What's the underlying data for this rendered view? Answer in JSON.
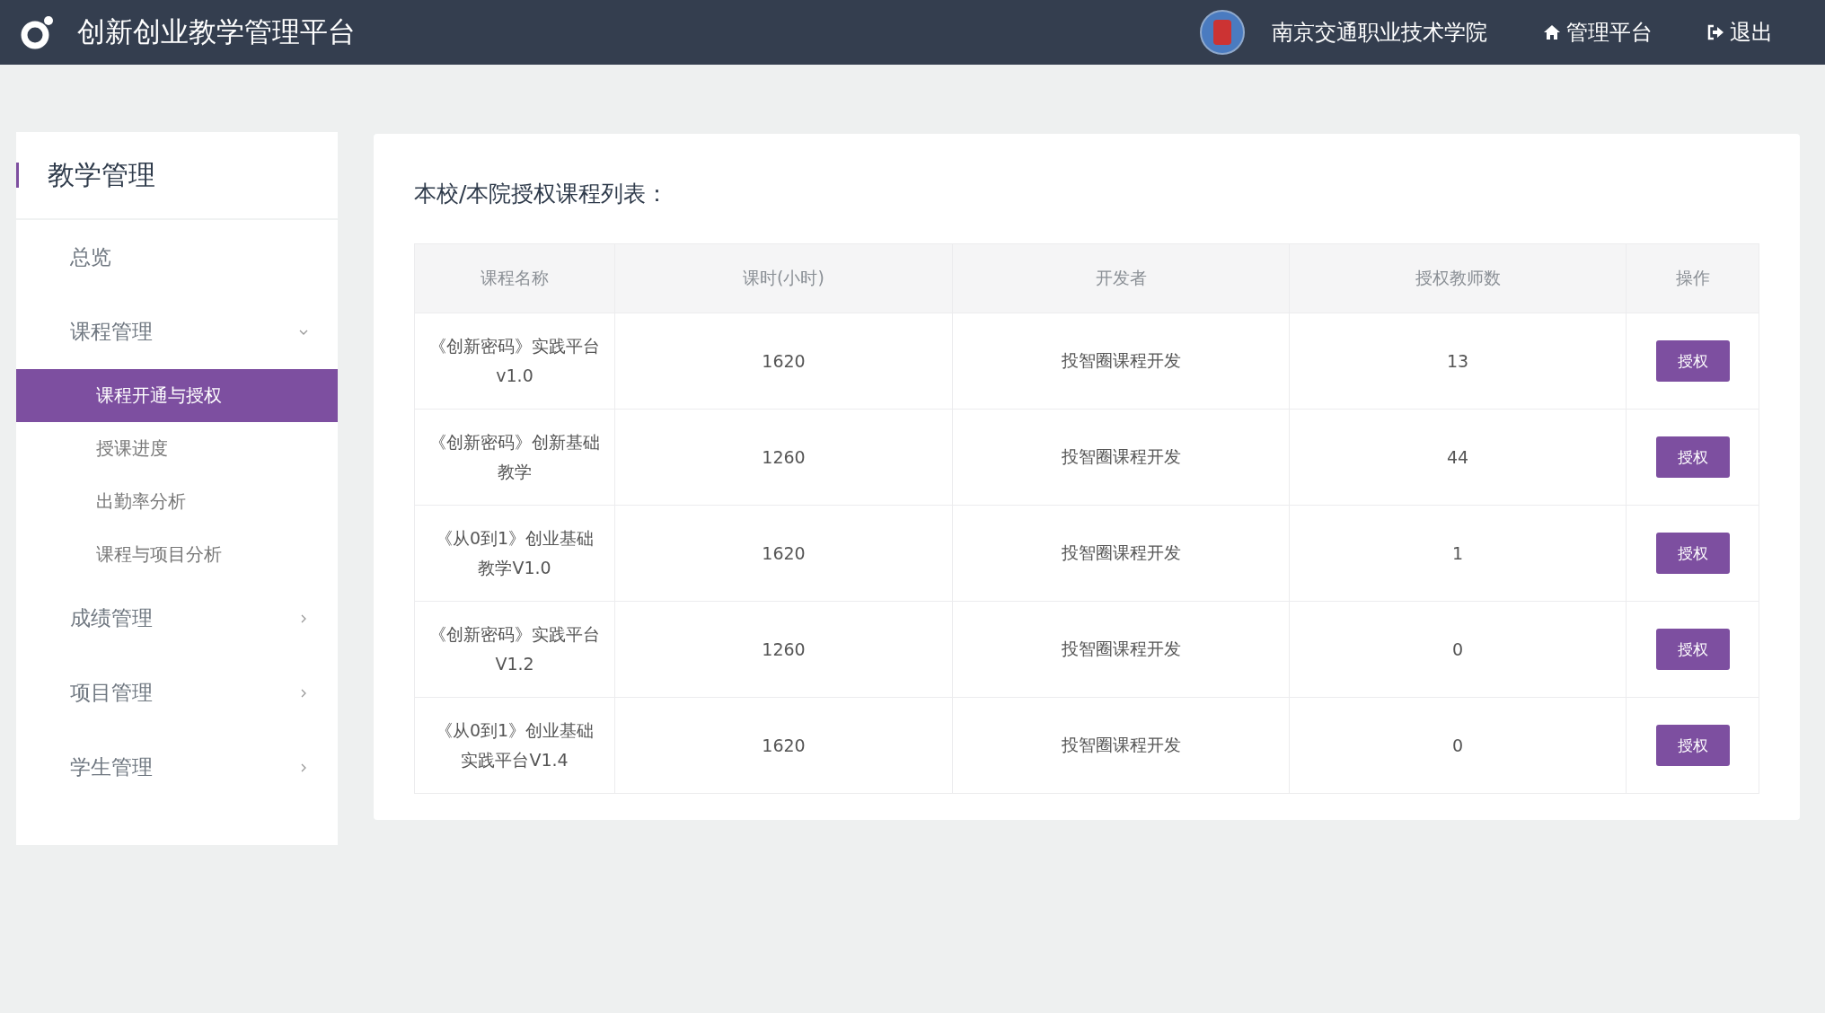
{
  "header": {
    "title": "创新创业教学管理平台",
    "school": "南京交通职业技术学院",
    "links": [
      {
        "kind": "home",
        "label": "管理平台"
      },
      {
        "kind": "logout",
        "label": "退出"
      }
    ]
  },
  "sidebar": {
    "title": "教学管理",
    "items": [
      {
        "kind": "link",
        "label": "总览"
      },
      {
        "kind": "group",
        "label": "课程管理",
        "expanded": true,
        "children": [
          {
            "label": "课程开通与授权",
            "selected": true
          },
          {
            "label": "授课进度",
            "selected": false
          },
          {
            "label": "出勤率分析",
            "selected": false
          },
          {
            "label": "课程与项目分析",
            "selected": false
          }
        ]
      },
      {
        "kind": "group",
        "label": "成绩管理",
        "expanded": false
      },
      {
        "kind": "group",
        "label": "项目管理",
        "expanded": false
      },
      {
        "kind": "group",
        "label": "学生管理",
        "expanded": false
      }
    ]
  },
  "content": {
    "heading": "本校/本院授权课程列表：",
    "table": {
      "columns": [
        "课程名称",
        "课时(小时)",
        "开发者",
        "授权教师数",
        "操作"
      ],
      "rows": [
        {
          "name": "《创新密码》实践平台v1.0",
          "hours": "1620",
          "developer": "投智圈课程开发",
          "teachers": "13",
          "action": "授权"
        },
        {
          "name": "《创新密码》创新基础教学",
          "hours": "1260",
          "developer": "投智圈课程开发",
          "teachers": "44",
          "action": "授权"
        },
        {
          "name": "《从0到1》创业基础教学V1.0",
          "hours": "1620",
          "developer": "投智圈课程开发",
          "teachers": "1",
          "action": "授权"
        },
        {
          "name": "《创新密码》实践平台V1.2",
          "hours": "1260",
          "developer": "投智圈课程开发",
          "teachers": "0",
          "action": "授权"
        },
        {
          "name": "《从0到1》创业基础实践平台V1.4",
          "hours": "1620",
          "developer": "投智圈课程开发",
          "teachers": "0",
          "action": "授权"
        }
      ]
    }
  }
}
